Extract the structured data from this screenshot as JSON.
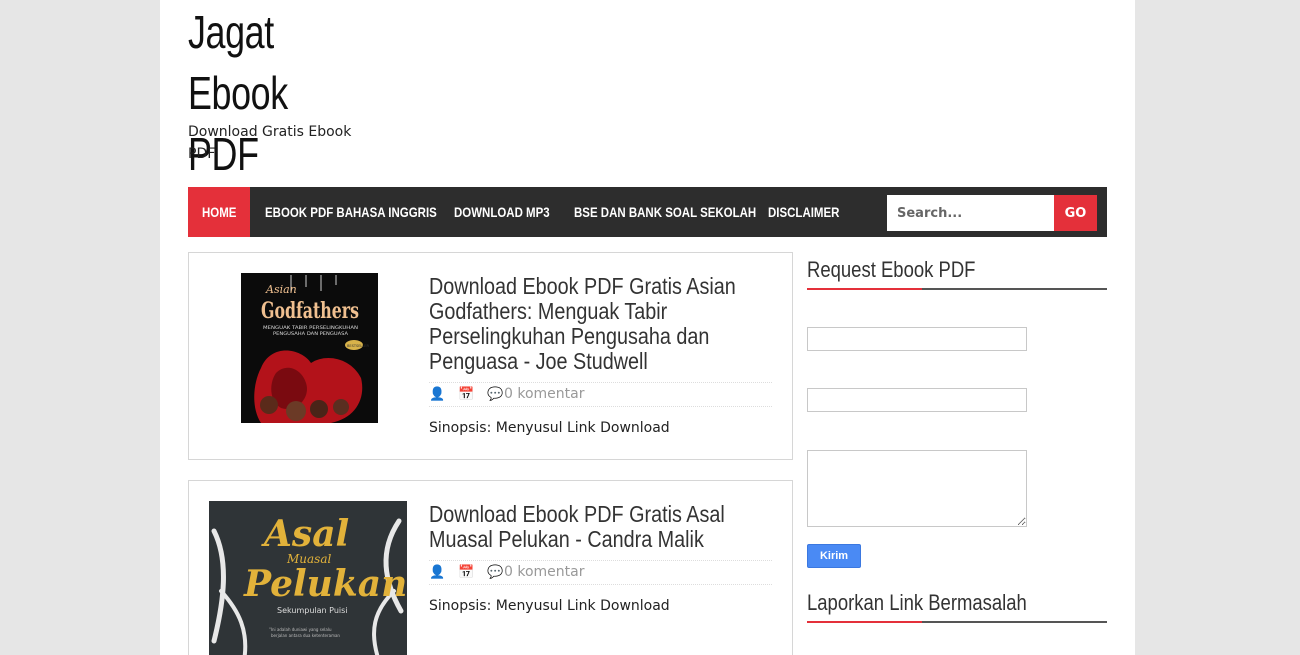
{
  "site": {
    "title": "Jagat Ebook PDF",
    "description": "Download Gratis Ebook PDF"
  },
  "nav": {
    "items": [
      "HOME",
      "EBOOK PDF BAHASA INGGRIS",
      "DOWNLOAD MP3",
      "BSE DAN BANK SOAL SEKOLAH",
      "DISCLAIMER"
    ],
    "search_placeholder": "Search...",
    "search_button": "GO"
  },
  "posts": [
    {
      "title": "Download Ebook PDF Gratis Asian Godfathers: Menguak Tabir Perselingkuhan Pengusaha dan Penguasa - Joe Studwell",
      "comments": "0 komentar",
      "excerpt": "Sinopsis: Menyusul Link Download",
      "cover_title": "Asian Godfathers",
      "cover_subtitle": "MENGUAK TABIR PERSELINGKUHAN PENGUSAHA DAN PENGUASA",
      "cover_badge": "BESTSELLER"
    },
    {
      "title": "Download Ebook PDF Gratis Asal Muasal Pelukan - Candra Malik",
      "comments": "0 komentar",
      "excerpt": "Sinopsis: Menyusul Link Download",
      "cover_title": "Asal Muasal Pelukan",
      "cover_subtitle": "Sekumpulan Puisi"
    }
  ],
  "sidebar": {
    "widget1_title": "Request Ebook PDF",
    "send_button": "Kirim",
    "widget2_title": "Laporkan Link Bermasalah"
  },
  "colors": {
    "accent": "#e4303a",
    "nav_bg": "#2d2d2d",
    "button_blue": "#4a8af4"
  }
}
